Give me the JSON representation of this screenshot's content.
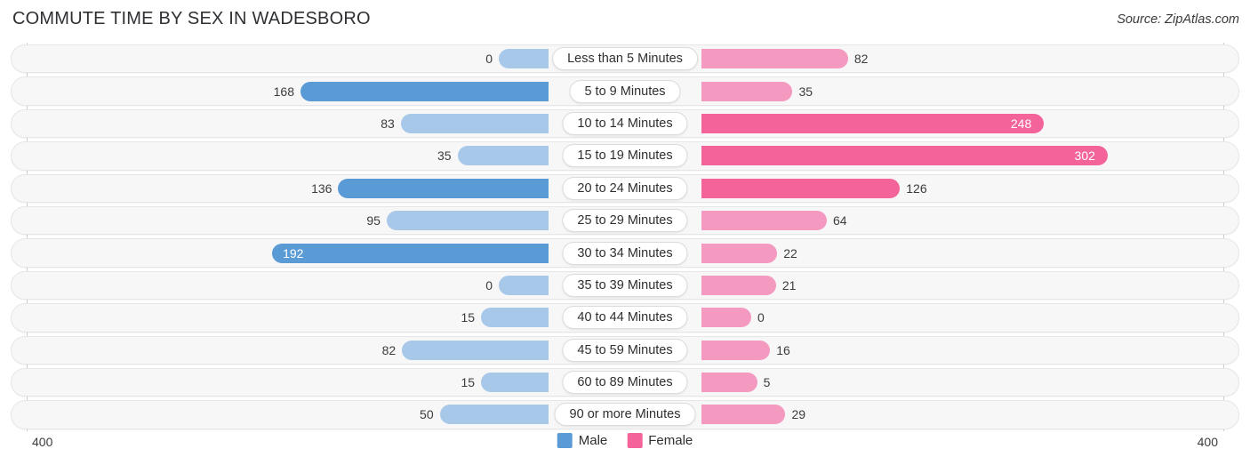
{
  "header": {
    "title": "COMMUTE TIME BY SEX IN WADESBORO",
    "source": "Source: ZipAtlas.com"
  },
  "axis": {
    "left_min_label": "400",
    "right_min_label": "400",
    "max": 400
  },
  "legend": {
    "items": [
      {
        "label": "Male",
        "color": "#5b9bd5"
      },
      {
        "label": "Female",
        "color": "#f4649a"
      }
    ]
  },
  "colors": {
    "male_light": "#a8c8ea",
    "male_dark": "#5b9bd5",
    "female_light": "#f49ac1",
    "female_dark": "#f4649a",
    "track_bg": "#f7f7f7",
    "track_border": "#e6e6e6"
  },
  "chart_data": {
    "type": "bar",
    "orientation": "horizontal-diverging",
    "title": "COMMUTE TIME BY SEX IN WADESBORO",
    "xlabel": "",
    "ylabel": "",
    "xlim": [
      400,
      0,
      400
    ],
    "grid": false,
    "legend_position": "bottom-center",
    "categories": [
      "Less than 5 Minutes",
      "5 to 9 Minutes",
      "10 to 14 Minutes",
      "15 to 19 Minutes",
      "20 to 24 Minutes",
      "25 to 29 Minutes",
      "30 to 34 Minutes",
      "35 to 39 Minutes",
      "40 to 44 Minutes",
      "45 to 59 Minutes",
      "60 to 89 Minutes",
      "90 or more Minutes"
    ],
    "series": [
      {
        "name": "Male",
        "values": [
          0,
          168,
          83,
          35,
          136,
          95,
          192,
          0,
          15,
          82,
          15,
          50
        ]
      },
      {
        "name": "Female",
        "values": [
          82,
          35,
          248,
          302,
          126,
          64,
          22,
          21,
          0,
          16,
          5,
          29
        ]
      }
    ]
  },
  "rows": [
    {
      "label": "Less than 5 Minutes",
      "male": "0",
      "female": "82",
      "male_value": 0,
      "female_value": 82
    },
    {
      "label": "5 to 9 Minutes",
      "male": "168",
      "female": "35",
      "male_value": 168,
      "female_value": 35
    },
    {
      "label": "10 to 14 Minutes",
      "male": "83",
      "female": "248",
      "male_value": 83,
      "female_value": 248
    },
    {
      "label": "15 to 19 Minutes",
      "male": "35",
      "female": "302",
      "male_value": 35,
      "female_value": 302
    },
    {
      "label": "20 to 24 Minutes",
      "male": "136",
      "female": "126",
      "male_value": 136,
      "female_value": 126
    },
    {
      "label": "25 to 29 Minutes",
      "male": "95",
      "female": "64",
      "male_value": 95,
      "female_value": 64
    },
    {
      "label": "30 to 34 Minutes",
      "male": "192",
      "female": "22",
      "male_value": 192,
      "female_value": 22
    },
    {
      "label": "35 to 39 Minutes",
      "male": "0",
      "female": "21",
      "male_value": 0,
      "female_value": 21
    },
    {
      "label": "40 to 44 Minutes",
      "male": "15",
      "female": "0",
      "male_value": 15,
      "female_value": 0
    },
    {
      "label": "45 to 59 Minutes",
      "male": "82",
      "female": "16",
      "male_value": 82,
      "female_value": 16
    },
    {
      "label": "60 to 89 Minutes",
      "male": "15",
      "female": "5",
      "male_value": 15,
      "female_value": 5
    },
    {
      "label": "90 or more Minutes",
      "male": "50",
      "female": "29",
      "male_value": 50,
      "female_value": 29
    }
  ]
}
